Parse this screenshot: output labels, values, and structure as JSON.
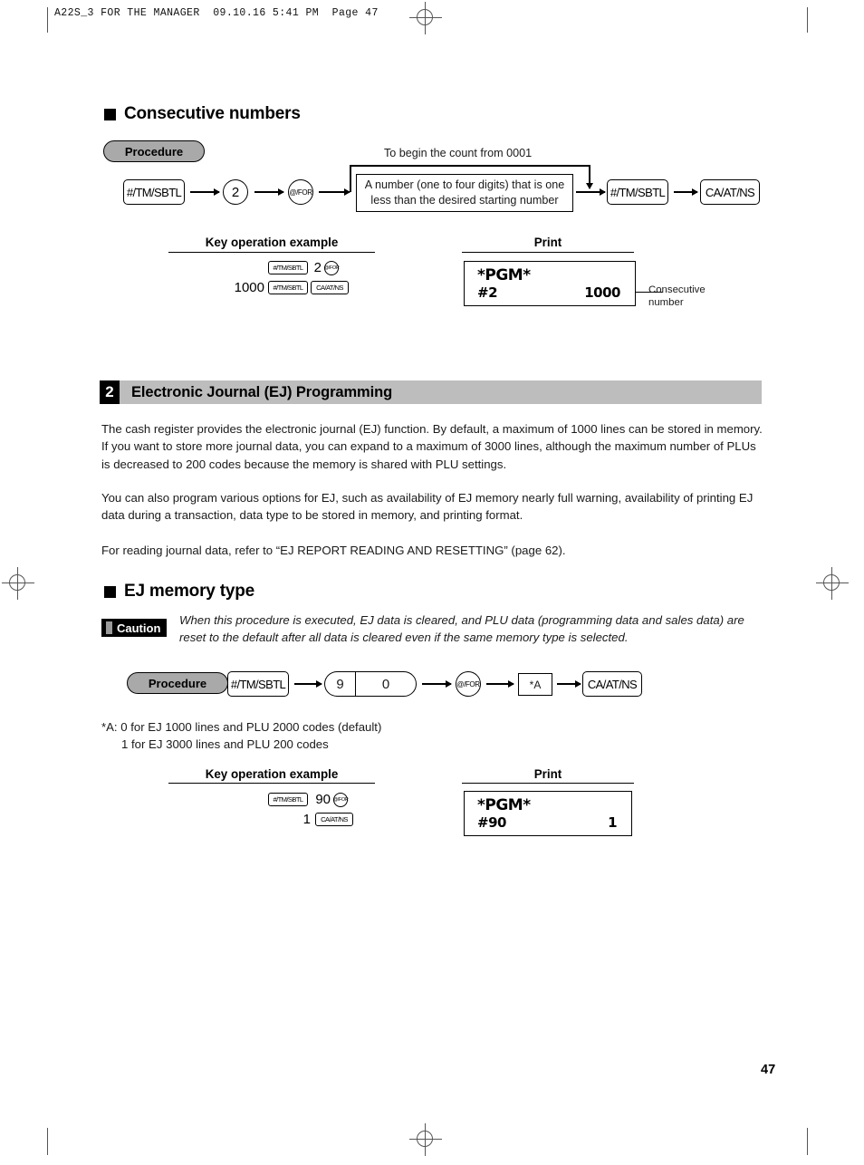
{
  "running_head": "A22S_3 FOR THE MANAGER  09.10.16 5:41 PM  Page 47",
  "page_number": "47",
  "section_consecutive": {
    "heading": "Consecutive numbers",
    "procedure_label": "Procedure",
    "flow": {
      "key1": "#/TM/SBTL",
      "key2": "2",
      "key3": "@/FOR",
      "note_box": "A number (one to four digits) that is one less than the desired starting number",
      "bypass_label": "To begin the count from 0001",
      "key4": "#/TM/SBTL",
      "key5": "CA/AT/NS"
    },
    "columns": {
      "key_operation": "Key operation example",
      "print": "Print"
    },
    "key_operation_example": {
      "row1_key1": "#/TM/SBTL",
      "row1_num": "2",
      "row1_key2": "@/FOR",
      "row2_num": "1000",
      "row2_key1": "#/TM/SBTL",
      "row2_key2": "CA/AT/NS"
    },
    "print_sample": {
      "title": "*PGM*",
      "line_label": "#2",
      "line_value": "1000"
    },
    "callout": "Consecutive number"
  },
  "section_ej": {
    "number": "2",
    "title": "Electronic Journal (EJ) Programming",
    "paragraph1": "The cash register provides the electronic journal (EJ) function.  By default, a maximum of 1000 lines can be stored in memory.  If you want to store more journal data, you can expand to a maximum of 3000 lines, although the maximum number of PLUs is decreased to 200 codes because the memory is shared with PLU settings.",
    "paragraph2": "You can also program various options for EJ, such as availability of EJ memory nearly full warning, availability of printing EJ data during a transaction, data type to be stored in memory, and printing format.",
    "paragraph3": "For reading journal data, refer to “EJ REPORT READING AND RESETTING” (page 62).",
    "memory_type": {
      "heading": "EJ memory type",
      "caution_label": "Caution",
      "caution_text": "When this procedure is executed, EJ data is cleared, and PLU data (programming data and sales data) are reset to the default after all data is cleared even if the same memory type is selected.",
      "procedure_label": "Procedure",
      "flow": {
        "key1": "#/TM/SBTL",
        "key2": "9",
        "key3": "0",
        "key4": "@/FOR",
        "key5": "*A",
        "key6": "CA/AT/NS"
      },
      "footnote_line1": "*A: 0 for EJ 1000 lines and PLU 2000 codes (default)",
      "footnote_line2": "1 for EJ 3000 lines and PLU 200 codes",
      "columns": {
        "key_operation": "Key operation example",
        "print": "Print"
      },
      "key_operation_example": {
        "row1_key1": "#/TM/SBTL",
        "row1_num": "90",
        "row1_key2": "@/FOR",
        "row2_num": "1",
        "row2_key1": "CA/AT/NS"
      },
      "print_sample": {
        "title": "*PGM*",
        "line_label": "#90",
        "line_value": "1"
      }
    }
  }
}
